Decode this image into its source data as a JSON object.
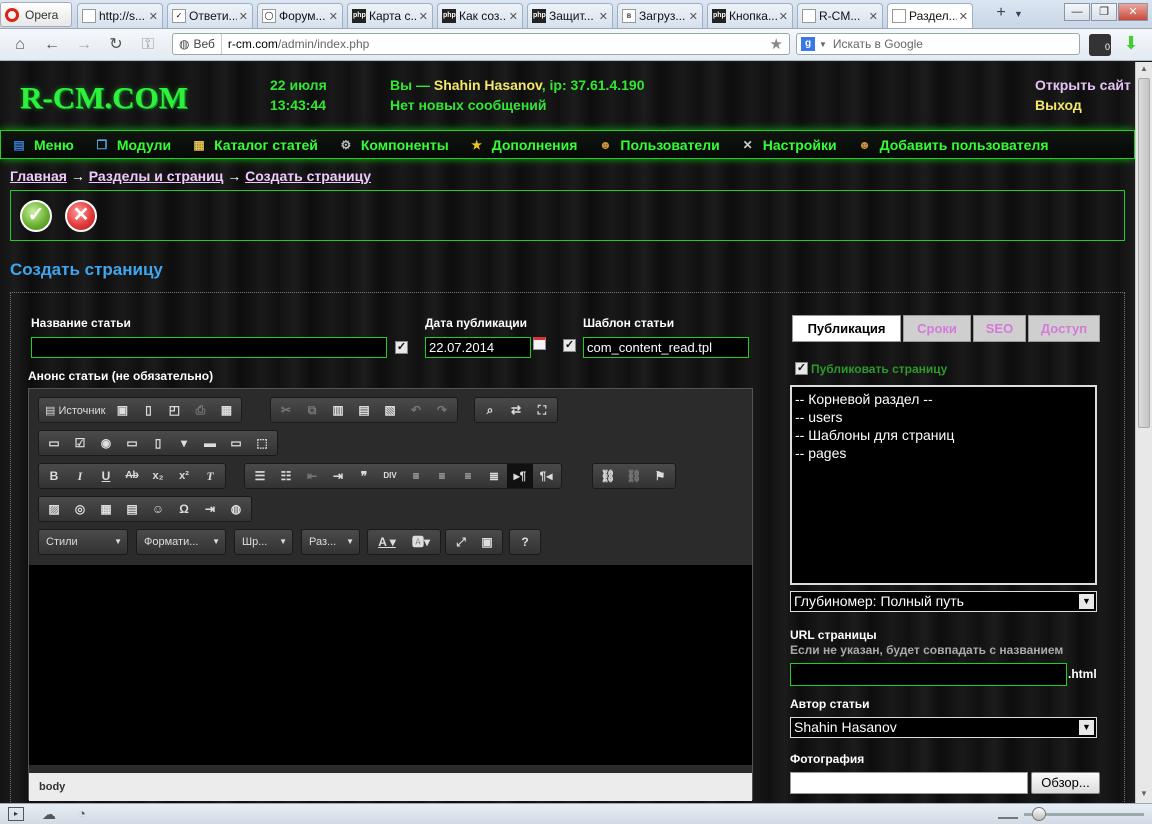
{
  "browser": {
    "app_label": "Opera",
    "tabs": [
      {
        "label": "http://s...",
        "icon": "page"
      },
      {
        "label": "Ответи...",
        "icon": "check"
      },
      {
        "label": "Форум...",
        "icon": "php-oval"
      },
      {
        "label": "Карта с...",
        "icon": "php"
      },
      {
        "label": "Как соз...",
        "icon": "php"
      },
      {
        "label": "Защит...",
        "icon": "php"
      },
      {
        "label": "Загруз...",
        "icon": "vk"
      },
      {
        "label": "Кнопка...",
        "icon": "php"
      },
      {
        "label": "R-CM...",
        "icon": "page"
      },
      {
        "label": "Раздел...",
        "icon": "page",
        "active": true
      }
    ],
    "web_label": "Веб",
    "url_domain": "r-cm.com",
    "url_path": "/admin/index.php",
    "search_placeholder": "Искать в Google",
    "badge_count": "0"
  },
  "header": {
    "logo": "R-CM.COM",
    "date": "22 июля",
    "time": "13:43:44",
    "you_prefix": "Вы —",
    "username": "Shahin Hasanov",
    "ip_text": ", ip: 37.61.4.190",
    "messages": "Нет новых сообщений",
    "open_site": "Открыть сайт",
    "logout": "Выход"
  },
  "menu": [
    {
      "label": "Меню",
      "icon": "menu-icon",
      "color": "#3a7bd5"
    },
    {
      "label": "Модули",
      "icon": "modules-icon",
      "color": "#5aa0e6"
    },
    {
      "label": "Каталог статей",
      "icon": "catalog-icon",
      "color": "#e0c050"
    },
    {
      "label": "Компоненты",
      "icon": "gear-icon",
      "color": "#bbbbbb"
    },
    {
      "label": "Дополнения",
      "icon": "star-icon",
      "color": "#f0c020"
    },
    {
      "label": "Пользователи",
      "icon": "users-icon",
      "color": "#d09040"
    },
    {
      "label": "Настройки",
      "icon": "tools-icon",
      "color": "#cccccc"
    },
    {
      "label": "Добавить пользователя",
      "icon": "add-user-icon",
      "color": "#d09040"
    }
  ],
  "breadcrumb": {
    "home": "Главная",
    "arrow": "→",
    "sections": "Разделы и страниц",
    "current": "Создать страницу"
  },
  "page_title": "Создать страницу",
  "form": {
    "title_label": "Название статьи",
    "title_value": "",
    "date_label": "Дата публикации",
    "date_value": "22.07.2014",
    "template_label": "Шаблон статьи",
    "template_value": "com_content_read.tpl",
    "announce_label": "Анонс статьи (не обязательно)"
  },
  "editor": {
    "source_label": "Источник",
    "styles_label": "Стили",
    "format_label": "Формати...",
    "font_label": "Шр...",
    "size_label": "Раз...",
    "help_label": "?",
    "footer_path": "body"
  },
  "right_panel": {
    "tabs": [
      "Публикация",
      "Сроки",
      "SEO",
      "Доступ"
    ],
    "publish_label": "Публиковать страницу",
    "sections": [
      "-- Корневой раздел --",
      "-- users",
      "-- Шаблоны для страниц",
      "-- pages"
    ],
    "depth_select": "Глубиномер: Полный путь",
    "url_label": "URL страницы",
    "url_hint": "Если не указан, будет совпадать с названием",
    "url_value": "",
    "url_suffix": ".html",
    "author_label": "Автор статьи",
    "author_value": "Shahin Hasanov",
    "photo_label": "Фотография",
    "browse_button": "Обзор..."
  },
  "colors": {
    "accent_green": "#33ff33",
    "title_blue": "#3fa6ee",
    "link_lavender": "#f0c9ff"
  }
}
